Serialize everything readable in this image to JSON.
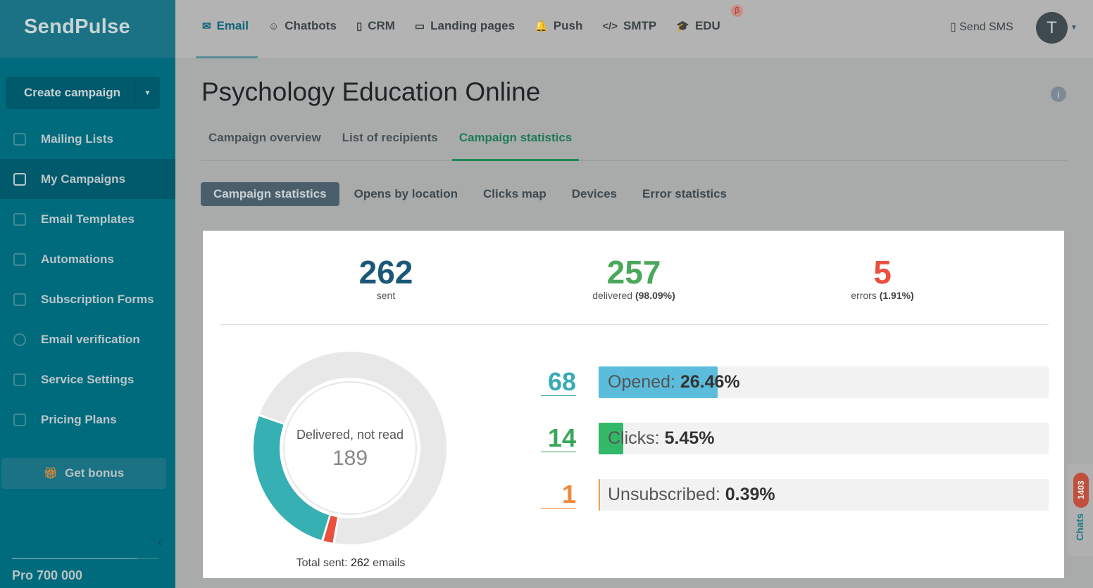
{
  "logo": "SendPulse",
  "sidebar": {
    "create": "Create campaign",
    "items": [
      {
        "label": "Mailing Lists"
      },
      {
        "label": "My Campaigns"
      },
      {
        "label": "Email Templates"
      },
      {
        "label": "Automations"
      },
      {
        "label": "Subscription Forms"
      },
      {
        "label": "Email verification"
      },
      {
        "label": "Service Settings"
      },
      {
        "label": "Pricing Plans"
      }
    ],
    "bonus": "Get bonus",
    "plan": "Pro 700 000",
    "plan_usage": 0.85
  },
  "topnav": {
    "items": [
      {
        "label": "Email",
        "icon": "✉"
      },
      {
        "label": "Chatbots",
        "icon": "☺"
      },
      {
        "label": "CRM",
        "icon": "▯"
      },
      {
        "label": "Landing pages",
        "icon": "▭"
      },
      {
        "label": "Push",
        "icon": "🔔"
      },
      {
        "label": "SMTP",
        "icon": "</>"
      },
      {
        "label": "EDU",
        "icon": "🎓"
      }
    ],
    "beta": "β",
    "sms": "Send SMS",
    "avatar": "T"
  },
  "page": {
    "title": "Psychology Education Online",
    "tabs": [
      "Campaign overview",
      "List of recipients",
      "Campaign statistics"
    ],
    "subtabs": [
      "Campaign statistics",
      "Opens by location",
      "Clicks map",
      "Devices",
      "Error statistics"
    ]
  },
  "stats": {
    "sent": {
      "n": "262",
      "label": "sent"
    },
    "delivered": {
      "n": "257",
      "label": "delivered",
      "pct": "(98.09%)"
    },
    "errors": {
      "n": "5",
      "label": "errors",
      "pct": "(1.91%)"
    }
  },
  "donut": {
    "center_label": "Delivered, not read",
    "center_value": "189",
    "total_prefix": "Total sent:",
    "total_value": "262",
    "total_suffix": "emails",
    "segments": [
      {
        "name": "Delivered, not read",
        "value": 189,
        "color": "#e8e8e8"
      },
      {
        "name": "Errors",
        "value": 5,
        "color": "#e9503f"
      },
      {
        "name": "Opened",
        "value": 68,
        "color": "#36b0b3"
      }
    ]
  },
  "metrics": [
    {
      "n": "68",
      "label": "Opened:",
      "pct": "26.46%",
      "frac": 0.2646,
      "color": "#5bbcdc",
      "ncolor": "#3aaab8"
    },
    {
      "n": "14",
      "label": "Clicks:",
      "pct": "5.45%",
      "frac": 0.0545,
      "color": "#33b86a",
      "ncolor": "#3aa65a"
    },
    {
      "n": "1",
      "label": "Unsubscribed:",
      "pct": "0.39%",
      "frac": 0.0039,
      "color": "#f0a050",
      "ncolor": "#f08a3a"
    }
  ],
  "chats": {
    "label": "Chats",
    "count": "1403"
  }
}
